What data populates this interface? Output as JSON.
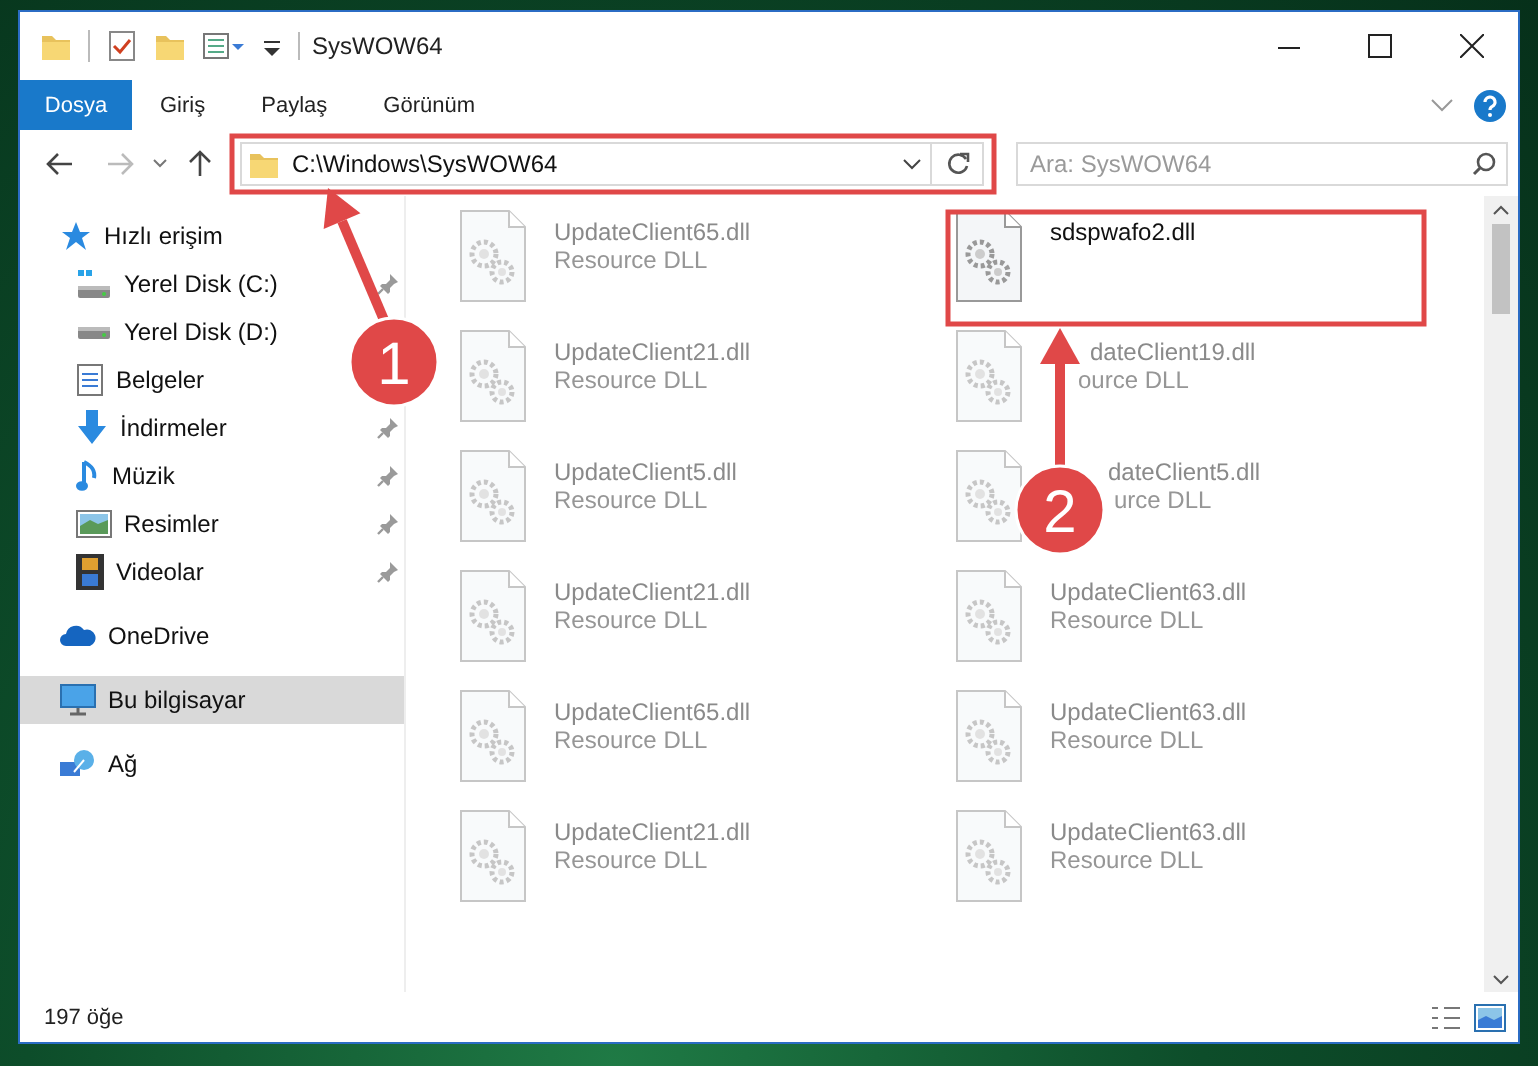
{
  "window": {
    "title": "SysWOW64"
  },
  "ribbon": {
    "file_tab": "Dosya",
    "tabs": [
      {
        "label": "Giriş",
        "selected": false
      },
      {
        "label": "Paylaş",
        "selected": false
      },
      {
        "label": "Görünüm",
        "selected": false
      }
    ]
  },
  "address_bar": {
    "path": "C:\\Windows\\SysWOW64"
  },
  "search": {
    "placeholder": "Ara: SysWOW64"
  },
  "navigation": {
    "items": [
      {
        "label": "Hızlı erişim",
        "kind": "quick",
        "selected": false,
        "children": [
          {
            "label": "Yerel Disk (C:)",
            "kind": "system-drive",
            "pinned": true,
            "selected": false
          },
          {
            "label": "Yerel Disk (D:)",
            "kind": "drive",
            "pinned": false,
            "selected": false
          },
          {
            "label": "Belgeler",
            "kind": "documents",
            "pinned": false,
            "selected": false
          },
          {
            "label": "İndirmeler",
            "kind": "downloads",
            "pinned": true,
            "selected": false
          },
          {
            "label": "Müzik",
            "kind": "music",
            "pinned": true,
            "selected": false
          },
          {
            "label": "Resimler",
            "kind": "pictures",
            "pinned": true,
            "selected": false
          },
          {
            "label": "Videolar",
            "kind": "videos",
            "pinned": true,
            "selected": false
          }
        ]
      },
      {
        "label": "OneDrive",
        "kind": "cloud",
        "selected": false
      },
      {
        "label": "Bu bilgisayar",
        "kind": "computer",
        "selected": true
      },
      {
        "label": "Ağ",
        "kind": "network",
        "selected": false
      }
    ]
  },
  "files": [
    {
      "name": "UpdateClient65.dll",
      "type": "Resource DLL",
      "dimmed": true
    },
    {
      "name": "sdspwafo2.dll",
      "dimmed": false
    },
    {
      "name": "UpdateClient21.dll",
      "type": "Resource DLL",
      "dimmed": true
    },
    {
      "name": "dateClient19.dll",
      "type": "ource DLL",
      "dimmed": true
    },
    {
      "name": "UpdateClient5.dll",
      "type": "Resource DLL",
      "dimmed": true
    },
    {
      "name": "dateClient5.dll",
      "type": "urce DLL",
      "dimmed": true
    },
    {
      "name": "UpdateClient21.dll",
      "type": "Resource DLL",
      "dimmed": true
    },
    {
      "name": "UpdateClient63.dll",
      "type": "Resource DLL",
      "dimmed": true
    },
    {
      "name": "UpdateClient65.dll",
      "type": "Resource DLL",
      "dimmed": true
    },
    {
      "name": "UpdateClient63.dll",
      "type": "Resource DLL",
      "dimmed": true
    },
    {
      "name": "UpdateClient21.dll",
      "type": "Resource DLL",
      "dimmed": true
    },
    {
      "name": "UpdateClient63.dll",
      "type": "Resource DLL",
      "dimmed": true
    }
  ],
  "annotations": [
    {
      "label": "1"
    },
    {
      "label": "2"
    }
  ],
  "status_bar": {
    "item_count": "197 öğe"
  }
}
